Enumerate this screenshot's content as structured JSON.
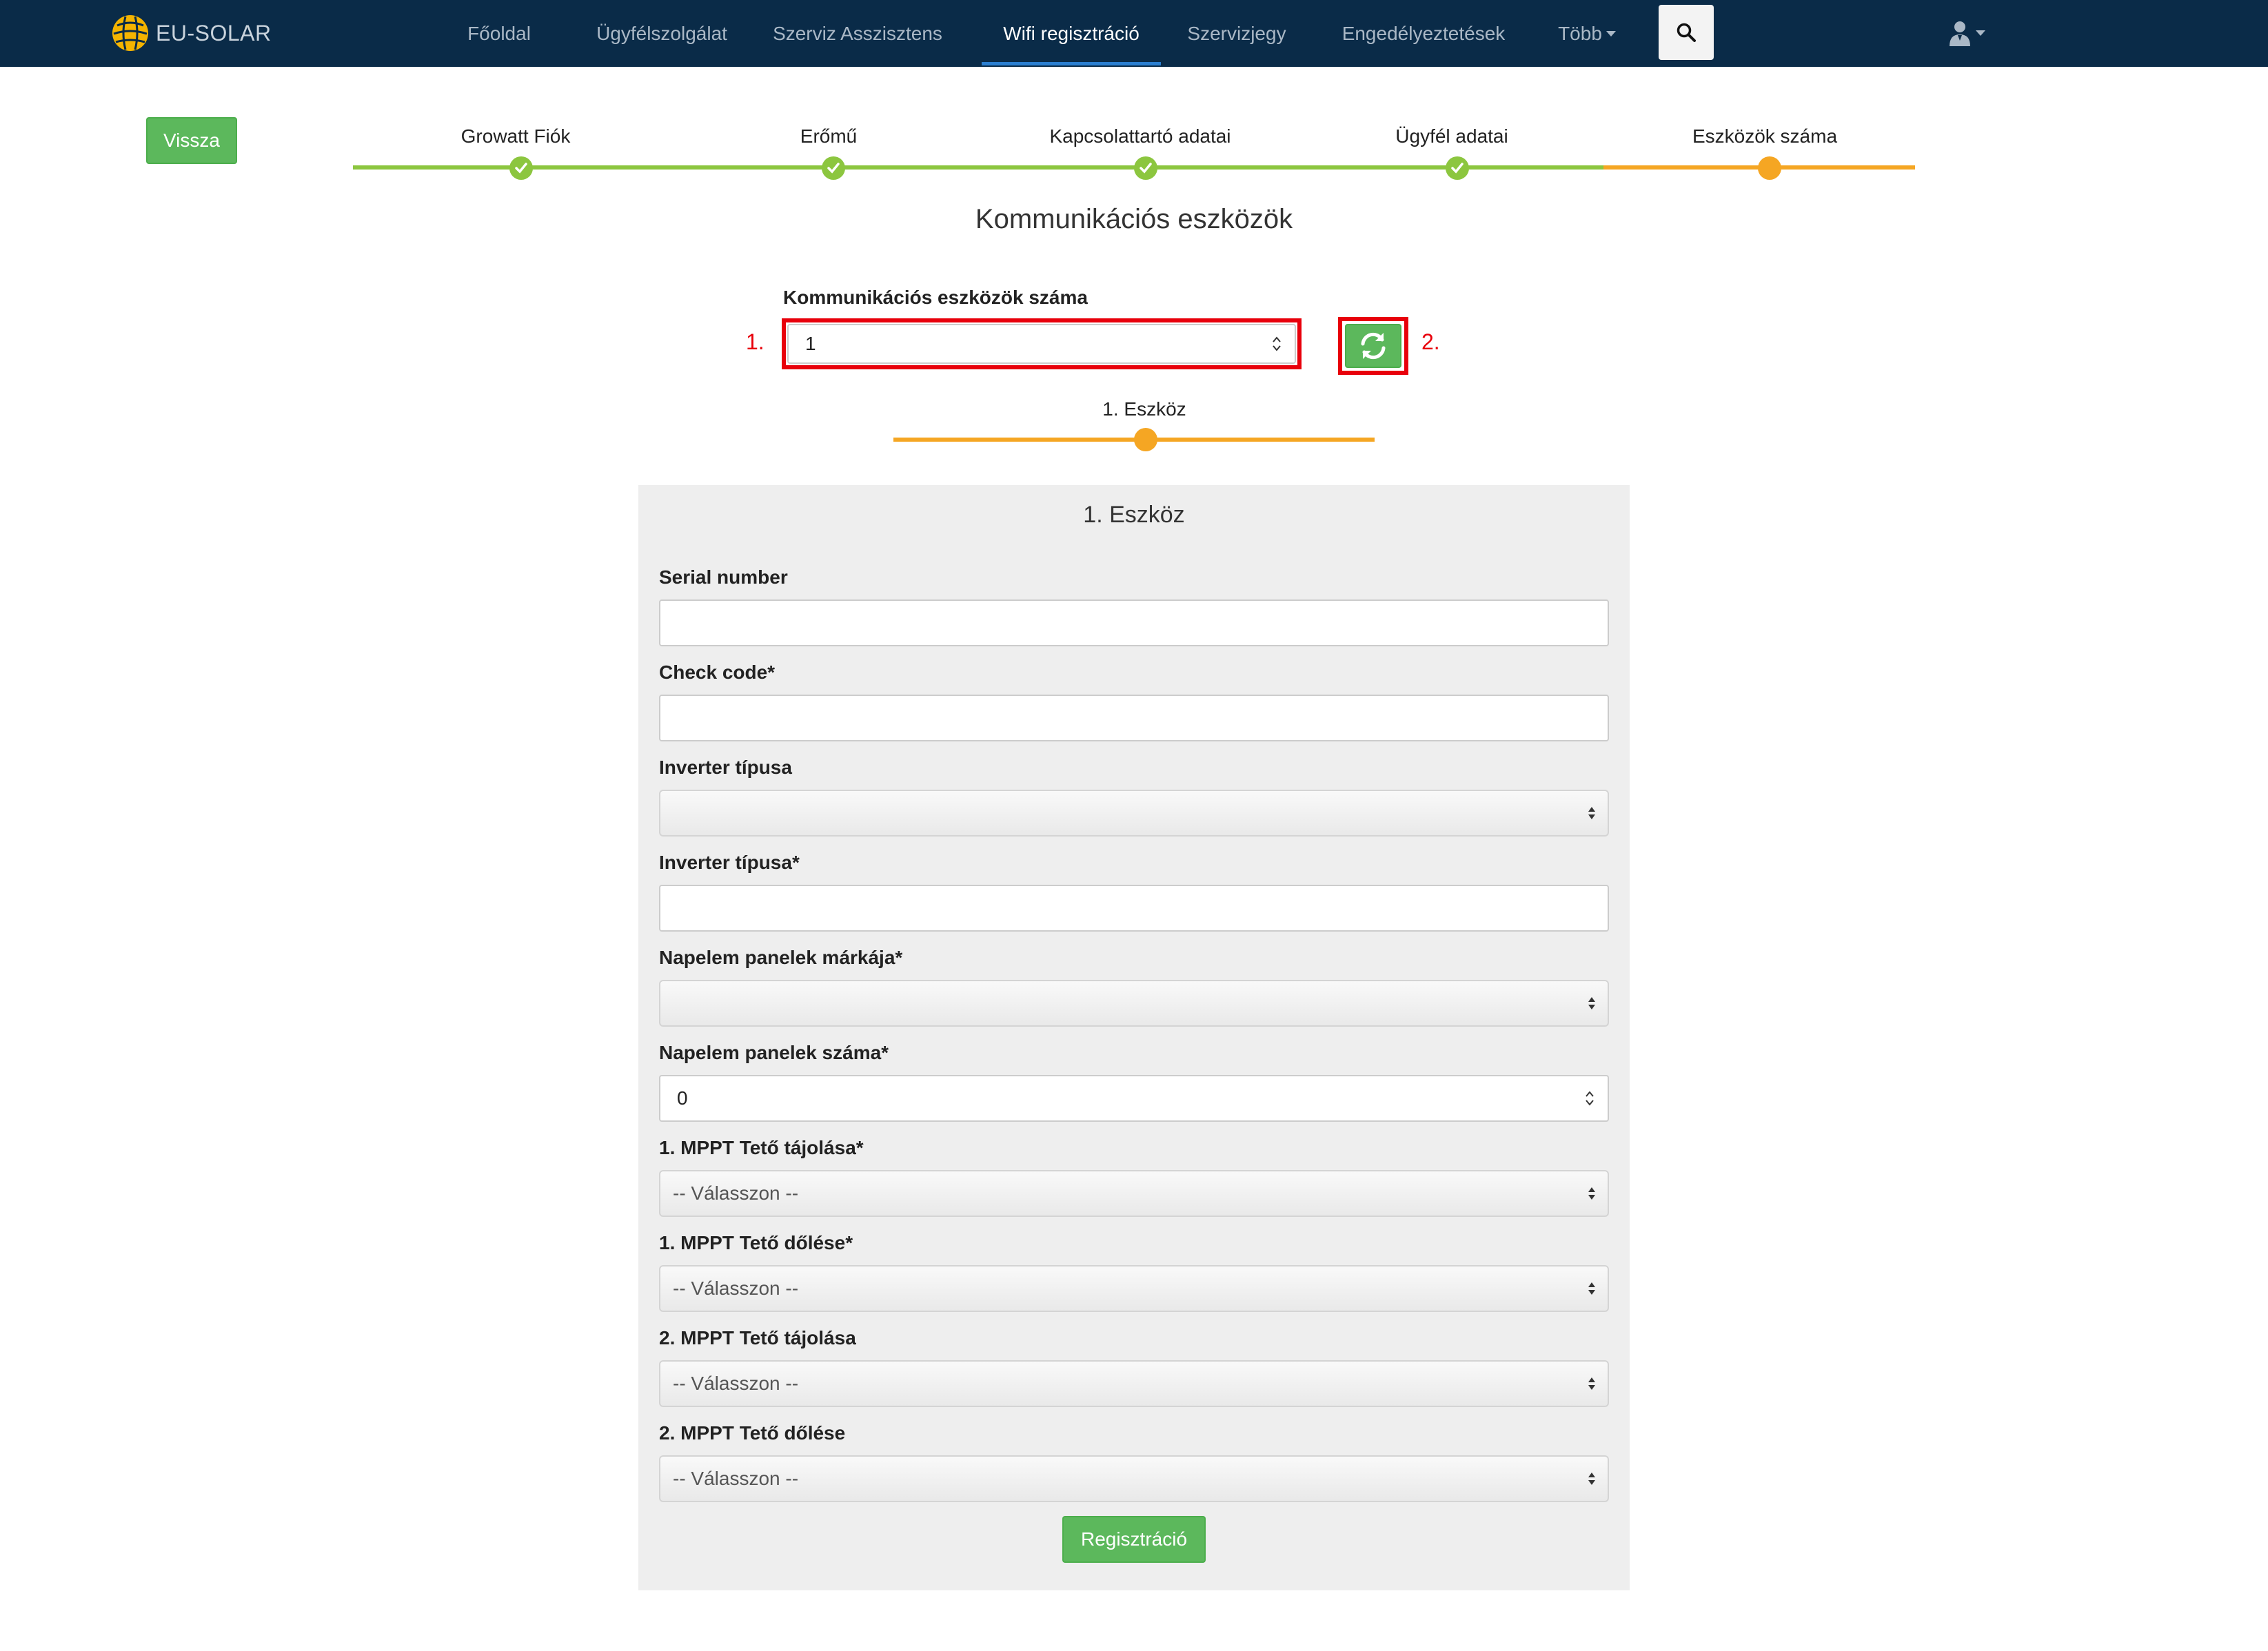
{
  "brand": {
    "name": "EU-SOLAR"
  },
  "nav": {
    "items": [
      {
        "label": "Főoldal"
      },
      {
        "label": "Ügyfélszolgálat"
      },
      {
        "label": "Szerviz Asszisztens"
      },
      {
        "label": "Wifi regisztráció",
        "active": true
      },
      {
        "label": "Szervizjegy"
      },
      {
        "label": "Engedélyeztetések"
      },
      {
        "label": "Több"
      }
    ],
    "search_icon": "search-icon",
    "user_icon": "user-icon"
  },
  "back_button": {
    "label": "Vissza"
  },
  "wizard": {
    "steps": [
      {
        "label": "Growatt Fiók",
        "state": "done"
      },
      {
        "label": "Erőmű",
        "state": "done"
      },
      {
        "label": "Kapcsolattartó adatai",
        "state": "done"
      },
      {
        "label": "Ügyfél adatai",
        "state": "done"
      },
      {
        "label": "Eszközök száma",
        "state": "current"
      }
    ]
  },
  "section_title": "Kommunikációs eszközök",
  "device_count": {
    "label": "Kommunikációs eszközök száma",
    "value": "1",
    "annotation_input": "1.",
    "annotation_button": "2.",
    "refresh_icon": "refresh-icon"
  },
  "device_stepper": {
    "label": "1. Eszköz"
  },
  "form": {
    "title": "1. Eszköz",
    "serial_label": "Serial number",
    "serial_value": "",
    "check_code_label": "Check code*",
    "check_code_value": "",
    "inverter_type_select_label": "Inverter típusa",
    "inverter_type_select_value": "",
    "inverter_type_text_label": "Inverter típusa*",
    "inverter_type_text_value": "",
    "panel_brand_label": "Napelem panelek márkája*",
    "panel_brand_value": "",
    "panel_count_label": "Napelem panelek száma*",
    "panel_count_value": "0",
    "mppt1_orientation_label": "1. MPPT Tető tájolása*",
    "mppt1_orientation_value": "-- Válasszon --",
    "mppt1_tilt_label": "1. MPPT Tető dőlése*",
    "mppt1_tilt_value": "-- Válasszon --",
    "mppt2_orientation_label": "2. MPPT Tető tájolása",
    "mppt2_orientation_value": "-- Válasszon --",
    "mppt2_tilt_label": "2. MPPT Tető dőlése",
    "mppt2_tilt_value": "-- Válasszon --",
    "submit_label": "Regisztráció"
  },
  "colors": {
    "navbar": "#0a2b48",
    "done": "#8cc63f",
    "current": "#f5a623",
    "button_green": "#5cb85c",
    "highlight_red": "#e8000b"
  }
}
